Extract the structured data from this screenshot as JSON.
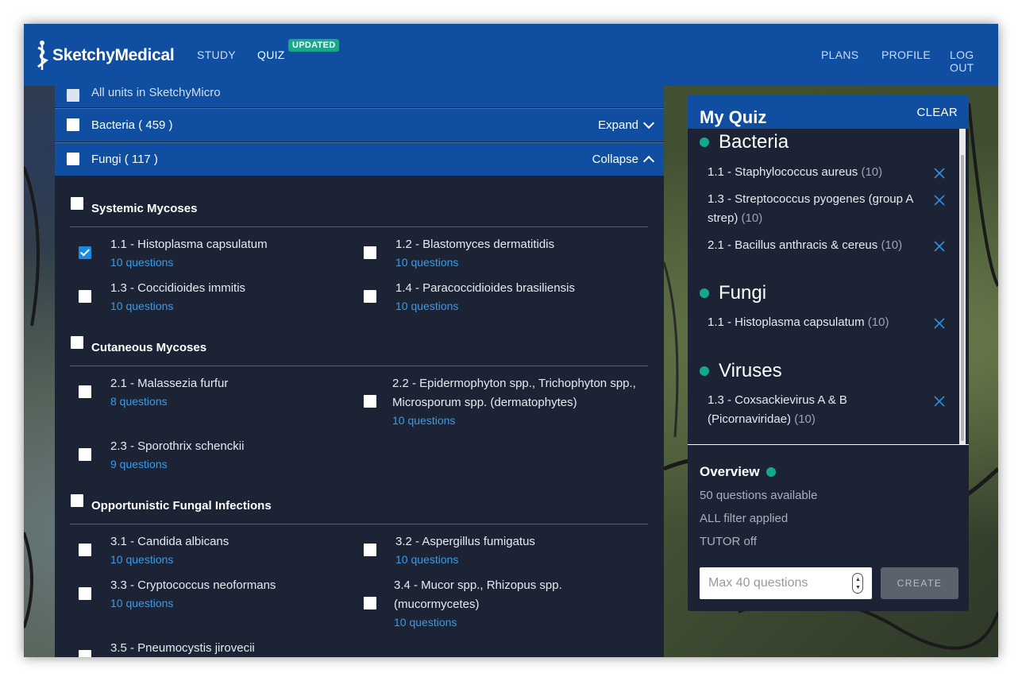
{
  "header": {
    "logo_text": "SketchyMedical",
    "nav": {
      "study": "STUDY",
      "quiz": "QUIZ",
      "quiz_badge": "UPDATED",
      "plans": "PLANS",
      "profile": "PROFILE",
      "logout": "LOG OUT"
    }
  },
  "units": {
    "all_label": "All units in SketchyMicro",
    "bacteria": {
      "label": "Bacteria ( 459 )",
      "toggle": "Expand"
    },
    "fungi": {
      "label": "Fungi ( 117 )",
      "toggle": "Collapse"
    }
  },
  "sections": [
    {
      "title": "Systemic Mycoses",
      "topics": [
        {
          "name": "1.1 - Histoplasma capsulatum",
          "count": "10 questions",
          "checked": true
        },
        {
          "name": "1.2 - Blastomyces dermatitidis",
          "count": "10 questions",
          "checked": false
        },
        {
          "name": "1.3 - Coccidioides immitis",
          "count": "10 questions",
          "checked": false
        },
        {
          "name": "1.4 - Paracoccidioides brasiliensis",
          "count": "10 questions",
          "checked": false
        }
      ]
    },
    {
      "title": "Cutaneous Mycoses",
      "topics": [
        {
          "name": "2.1 - Malassezia furfur",
          "count": "8 questions",
          "checked": false
        },
        {
          "name": "2.2 - Epidermophyton spp., Trichophyton spp., Microsporum spp. (dermatophytes)",
          "count": "10 questions",
          "checked": false
        },
        {
          "name": "2.3 - Sporothrix schenckii",
          "count": "9 questions",
          "checked": false
        }
      ]
    },
    {
      "title": "Opportunistic Fungal Infections",
      "topics": [
        {
          "name": "3.1 - Candida albicans",
          "count": "10 questions",
          "checked": false
        },
        {
          "name": "3.2 - Aspergillus fumigatus",
          "count": "10 questions",
          "checked": false
        },
        {
          "name": "3.3 - Cryptococcus neoformans",
          "count": "10 questions",
          "checked": false
        },
        {
          "name": "3.4 - Mucor spp., Rhizopus spp. (mucormycetes)",
          "count": "10 questions",
          "checked": false
        },
        {
          "name": "3.5 - Pneumocystis jirovecii",
          "count": "",
          "checked": false
        }
      ]
    }
  ],
  "my_quiz": {
    "title": "My Quiz",
    "clear": "CLEAR",
    "groups": [
      {
        "name": "Bacteria",
        "items": [
          {
            "name": "1.1 - Staphylococcus aureus",
            "count": "(10)"
          },
          {
            "name": "1.3 - Streptococcus pyogenes (group A strep)",
            "count": "(10)"
          },
          {
            "name": "2.1 - Bacillus anthracis & cereus",
            "count": "(10)"
          }
        ]
      },
      {
        "name": "Fungi",
        "items": [
          {
            "name": "1.1 - Histoplasma capsulatum",
            "count": "(10)"
          }
        ]
      },
      {
        "name": "Viruses",
        "items": [
          {
            "name": "1.3 - Coxsackievirus A & B (Picornaviridae)",
            "count": "(10)"
          }
        ]
      }
    ],
    "overview": {
      "title": "Overview",
      "available": "50 questions available",
      "filter": "ALL filter applied",
      "tutor": "TUTOR off"
    },
    "max_placeholder": "Max 40 questions",
    "create": "CREATE"
  },
  "colors": {
    "brand_blue": "#0f4ea0",
    "panel": "#1b2334",
    "accent_green": "#15a98b",
    "link_blue": "#3b9be8"
  }
}
